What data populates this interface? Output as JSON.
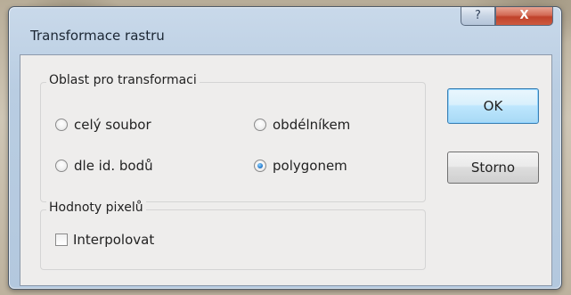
{
  "window": {
    "title": "Transformace rastru",
    "help_label": "?",
    "close_label": "X"
  },
  "area_group": {
    "title": "Oblast pro transformaci",
    "options": [
      {
        "label": "celý soubor",
        "checked": false
      },
      {
        "label": "obdélníkem",
        "checked": false
      },
      {
        "label": "dle id. bodů",
        "checked": false
      },
      {
        "label": "polygonem",
        "checked": true
      }
    ]
  },
  "pixel_group": {
    "title": "Hodnoty pixelů",
    "interpolate_label": "Interpolovat",
    "interpolate_checked": false
  },
  "buttons": {
    "ok_label": "OK",
    "cancel_label": "Storno"
  }
}
